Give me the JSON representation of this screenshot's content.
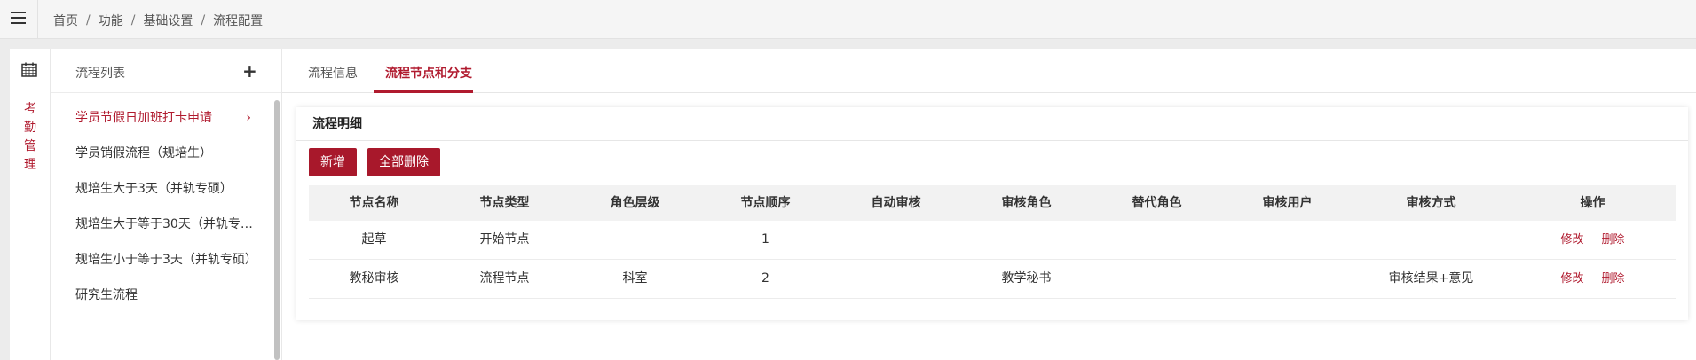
{
  "breadcrumb": [
    "首页",
    "功能",
    "基础设置",
    "流程配置"
  ],
  "side_module": [
    "考",
    "勤",
    "管",
    "理"
  ],
  "process_list": {
    "title": "流程列表",
    "add_icon": "plus-icon",
    "items": [
      {
        "label": "学员节假日加班打卡申请",
        "active": true
      },
      {
        "label": "学员销假流程（规培生）",
        "active": false
      },
      {
        "label": "规培生大于3天（并轨专硕）",
        "active": false
      },
      {
        "label": "规培生大于等于30天（并轨专硕…",
        "active": false
      },
      {
        "label": "规培生小于等于3天（并轨专硕）",
        "active": false
      },
      {
        "label": "研究生流程",
        "active": false
      }
    ]
  },
  "tabs": [
    {
      "label": "流程信息",
      "active": false
    },
    {
      "label": "流程节点和分支",
      "active": true
    }
  ],
  "detail": {
    "title": "流程明细",
    "add_label": "新增",
    "delete_all_label": "全部删除"
  },
  "table": {
    "columns": [
      "节点名称",
      "节点类型",
      "角色层级",
      "节点顺序",
      "自动审核",
      "审核角色",
      "替代角色",
      "审核用户",
      "审核方式",
      "操作"
    ],
    "rows": [
      {
        "name": "起草",
        "type": "开始节点",
        "role_level": "",
        "order": "1",
        "auto": "",
        "role": "",
        "alt_role": "",
        "user": "",
        "method": "",
        "edit": "修改",
        "delete": "删除"
      },
      {
        "name": "教秘审核",
        "type": "流程节点",
        "role_level": "科室",
        "order": "2",
        "auto": "",
        "role": "教学秘书",
        "alt_role": "",
        "user": "",
        "method": "审核结果+意见",
        "edit": "修改",
        "delete": "删除"
      }
    ]
  },
  "colors": {
    "accent": "#b01a2e",
    "button": "#a8182b"
  }
}
